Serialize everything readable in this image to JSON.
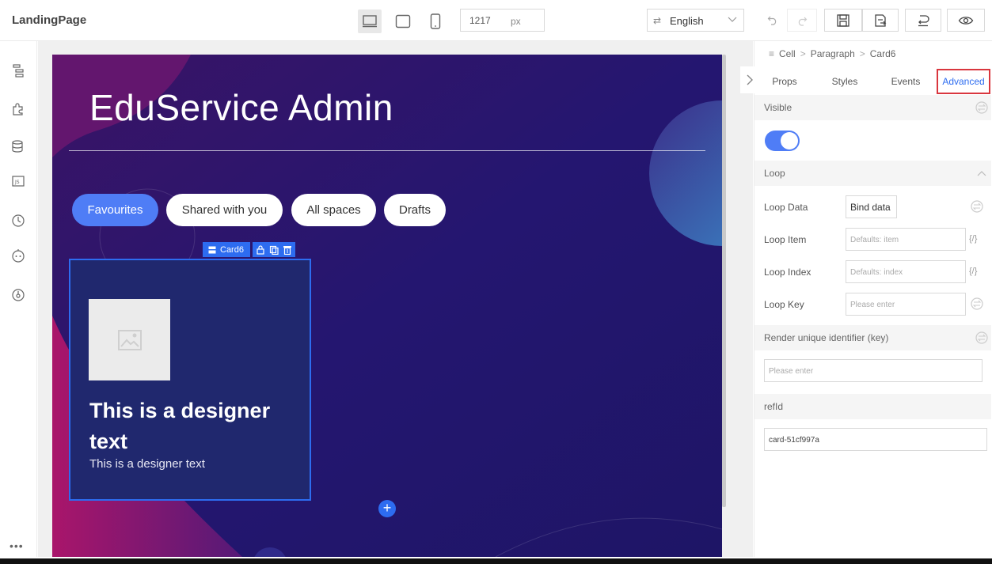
{
  "app": {
    "title": "LandingPage"
  },
  "toolbar": {
    "width_value": "1217",
    "width_unit": "px",
    "language": "English"
  },
  "canvas": {
    "hero_title": "EduService Admin",
    "pills": [
      "Favourites",
      "Shared with you",
      "All spaces",
      "Drafts"
    ],
    "selected_component": "Card6",
    "card": {
      "title": "This is a designer text",
      "subtitle": "This is a designer text"
    },
    "add_label": "+"
  },
  "panel": {
    "breadcrumb": [
      "Cell",
      "Paragraph",
      "Card6"
    ],
    "tabs": [
      "Props",
      "Styles",
      "Events",
      "Advanced"
    ],
    "active_tab": "Advanced",
    "visible_label": "Visible",
    "visible_on": true,
    "loop_section": "Loop",
    "loop_data_label": "Loop Data",
    "loop_data_value": "Bind data",
    "loop_item_label": "Loop Item",
    "loop_item_placeholder": "Defaults: item",
    "loop_index_label": "Loop Index",
    "loop_index_placeholder": "Defaults: index",
    "loop_key_label": "Loop Key",
    "loop_key_placeholder": "Please enter",
    "key_section": "Render unique identifier (key)",
    "key_placeholder": "Please enter",
    "refid_section": "refId",
    "refid_value": "card-51cf997a",
    "code_icon": "{/}"
  },
  "colors": {
    "accent": "#2d6cf0",
    "pill_active": "#4f7df6",
    "canvas_bg": "#2a1566",
    "tab_highlight": "#d9363e"
  }
}
